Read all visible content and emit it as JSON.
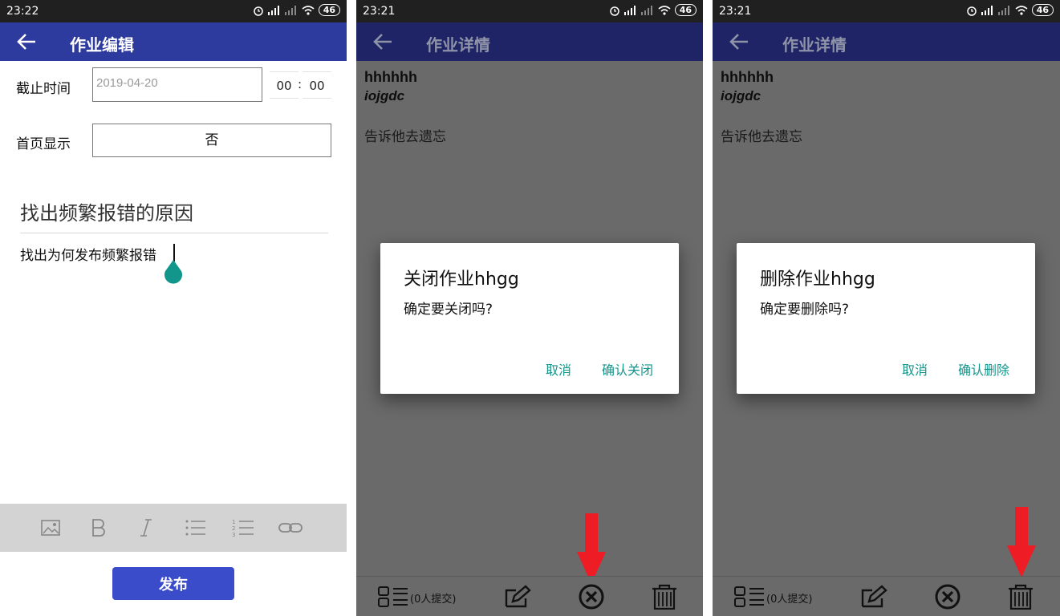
{
  "colors": {
    "appbar": "#2d3a9e",
    "appbar_dimmed": "#1f2466",
    "accent": "#12958a",
    "publish": "#3a4cc9",
    "overlay": "#6a6a6a",
    "arrow": "#ee1c24"
  },
  "screen1": {
    "status_time": "23:22",
    "battery": "46",
    "title": "作业编辑",
    "deadline_label": "截止时间",
    "deadline_placeholder": "2019-04-20",
    "hour": "00",
    "time_separator": ":",
    "minute": "00",
    "homepage_label": "首页显示",
    "homepage_value": "否",
    "edit_title": "找出频繁报错的原因",
    "edit_body": "找出为何发布频繁报错",
    "toolbar_icons": [
      "image-icon",
      "bold-icon",
      "italic-icon",
      "bullet-list-icon",
      "numbered-list-icon",
      "link-icon"
    ],
    "publish_label": "发布"
  },
  "screen2": {
    "status_time": "23:21",
    "battery": "46",
    "title": "作业详情",
    "detail_title": "hhhhhh",
    "detail_sub": "iojgdc",
    "detail_body": "告诉他去遗忘",
    "dialog_title": "关闭作业hhgg",
    "dialog_message": "确定要关闭吗?",
    "cancel_label": "取消",
    "confirm_label": "确认关闭",
    "submit_count": "(0人提交)",
    "highlight": "close-icon"
  },
  "screen3": {
    "status_time": "23:21",
    "battery": "46",
    "title": "作业详情",
    "detail_title": "hhhhhh",
    "detail_sub": "iojgdc",
    "detail_body": "告诉他去遗忘",
    "dialog_title": "删除作业hhgg",
    "dialog_message": "确定要删除吗?",
    "cancel_label": "取消",
    "confirm_label": "确认删除",
    "submit_count": "(0人提交)",
    "highlight": "trash-icon"
  }
}
